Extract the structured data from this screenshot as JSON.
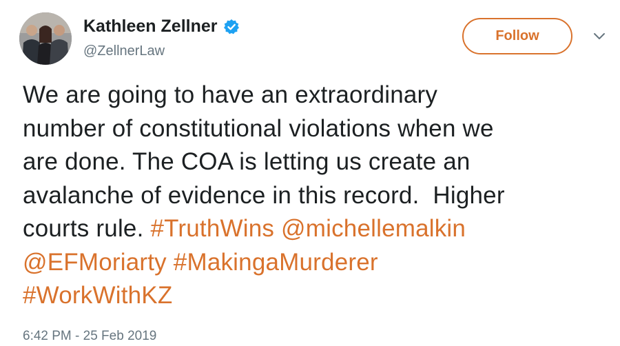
{
  "author": {
    "display_name": "Kathleen Zellner",
    "handle": "@ZellnerLaw",
    "verified": true
  },
  "actions": {
    "follow_label": "Follow"
  },
  "icons": {
    "verified": "verified-badge-icon",
    "menu": "chevron-down-icon"
  },
  "colors": {
    "accent": "#d9722c",
    "text": "#1c2022",
    "muted": "#66757f",
    "verified": "#1da1f2"
  },
  "tweet": {
    "line1": "We are going to have an extraordinary",
    "line2": "number of constitutional violations when we",
    "line3": "are done. The COA is letting us create an",
    "line4": "avalanche of evidence in this record.  Higher",
    "line5_text": "courts rule. ",
    "hashtag_truthwins": "#TruthWins",
    "mention_michellemalkin": "@michellemalkin",
    "mention_efmoriarty": "@EFMoriarty",
    "hashtag_makingamurderer": "#MakingaMurderer",
    "hashtag_workwithkz": "#WorkWithKZ",
    "timestamp": "6:42 PM - 25 Feb 2019"
  }
}
